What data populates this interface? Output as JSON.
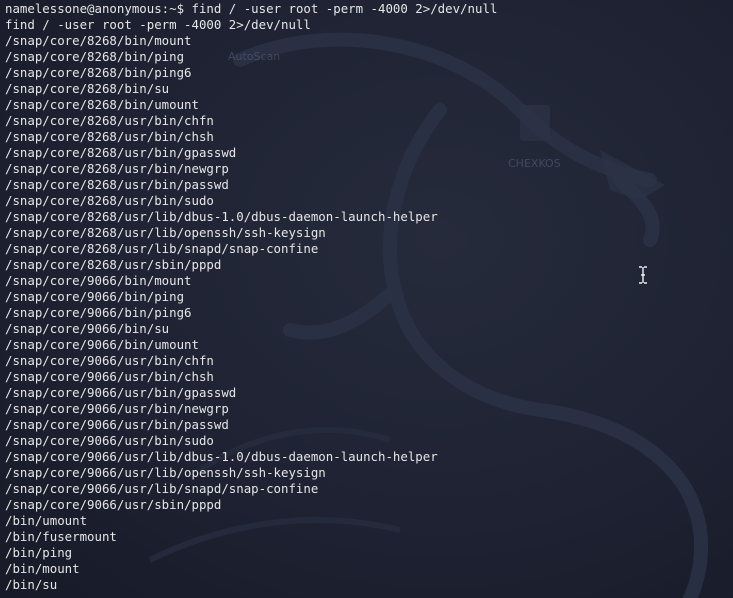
{
  "terminal": {
    "prompt_user_host": "namelessone@anonymous:~$",
    "command": " find / -user root -perm -4000 2>/dev/null",
    "echo_line": "find / -user root -perm -4000 2>/dev/null",
    "output": [
      "/snap/core/8268/bin/mount",
      "/snap/core/8268/bin/ping",
      "/snap/core/8268/bin/ping6",
      "/snap/core/8268/bin/su",
      "/snap/core/8268/bin/umount",
      "/snap/core/8268/usr/bin/chfn",
      "/snap/core/8268/usr/bin/chsh",
      "/snap/core/8268/usr/bin/gpasswd",
      "/snap/core/8268/usr/bin/newgrp",
      "/snap/core/8268/usr/bin/passwd",
      "/snap/core/8268/usr/bin/sudo",
      "/snap/core/8268/usr/lib/dbus-1.0/dbus-daemon-launch-helper",
      "/snap/core/8268/usr/lib/openssh/ssh-keysign",
      "/snap/core/8268/usr/lib/snapd/snap-confine",
      "/snap/core/8268/usr/sbin/pppd",
      "/snap/core/9066/bin/mount",
      "/snap/core/9066/bin/ping",
      "/snap/core/9066/bin/ping6",
      "/snap/core/9066/bin/su",
      "/snap/core/9066/bin/umount",
      "/snap/core/9066/usr/bin/chfn",
      "/snap/core/9066/usr/bin/chsh",
      "/snap/core/9066/usr/bin/gpasswd",
      "/snap/core/9066/usr/bin/newgrp",
      "/snap/core/9066/usr/bin/passwd",
      "/snap/core/9066/usr/bin/sudo",
      "/snap/core/9066/usr/lib/dbus-1.0/dbus-daemon-launch-helper",
      "/snap/core/9066/usr/lib/openssh/ssh-keysign",
      "/snap/core/9066/usr/lib/snapd/snap-confine",
      "/snap/core/9066/usr/sbin/pppd",
      "/bin/umount",
      "/bin/fusermount",
      "/bin/ping",
      "/bin/mount",
      "/bin/su"
    ]
  },
  "desktop_ghosts": {
    "label_1": "AutoScan",
    "label_2": "CHEXKOS"
  },
  "colors": {
    "background": "#1e2232",
    "text": "#e6e6e6",
    "wallpaper_dragon": "#2a3044"
  },
  "icons": {
    "cursor": "i-beam-cursor-icon",
    "wallpaper": "kali-dragon-icon"
  }
}
